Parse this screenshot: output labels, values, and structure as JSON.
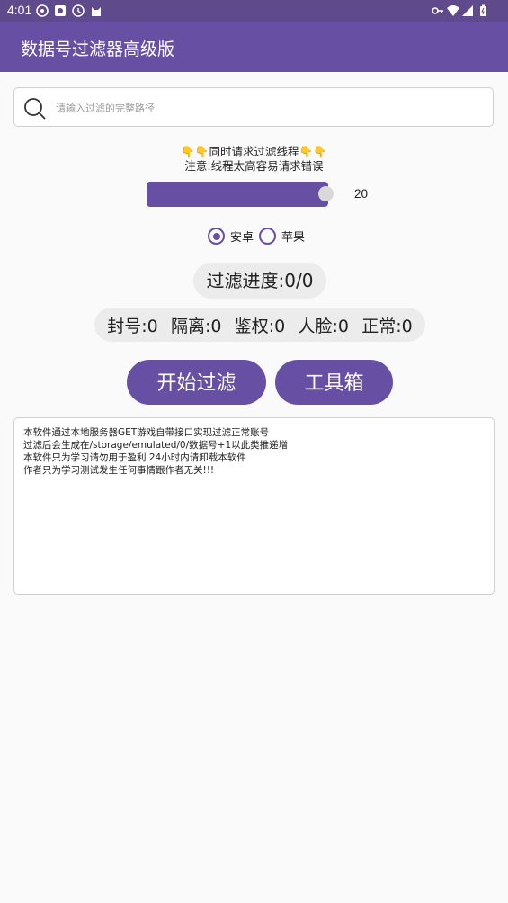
{
  "status_bar": {
    "time": "4:01"
  },
  "app_bar": {
    "title": "数据号过滤器高级版"
  },
  "search": {
    "placeholder": "请输入过滤的完整路径",
    "value": ""
  },
  "notice": {
    "line1": "👇👇同时请求过滤线程👇👇",
    "line2": "注意:线程太高容易请求错误"
  },
  "thread_slider": {
    "value": "20",
    "fill_fraction": 0.95
  },
  "platform": {
    "options": [
      {
        "label": "安卓",
        "selected": true
      },
      {
        "label": "苹果",
        "selected": false
      }
    ]
  },
  "progress": {
    "text": "过滤进度:0/0"
  },
  "stats": {
    "banned": "封号:0",
    "isolated": "隔离:0",
    "auth": "鉴权:0",
    "face": "人脸:0",
    "normal": "正常:0"
  },
  "buttons": {
    "start": "开始过滤",
    "tools": "工具箱"
  },
  "log": {
    "lines": [
      "本软件通过本地服务器GET游戏自带接口实现过滤正常账号",
      "过滤后会生成在/storage/emulated/0/数据号+1以此类推递增",
      "本软件只为学习请勿用于盈利 24小时内请卸载本软件",
      "作者只为学习测试发生任何事情跟作者无关!!!"
    ]
  },
  "colors": {
    "primary": "#6750a4",
    "status_bar": "#5f4b8b"
  }
}
